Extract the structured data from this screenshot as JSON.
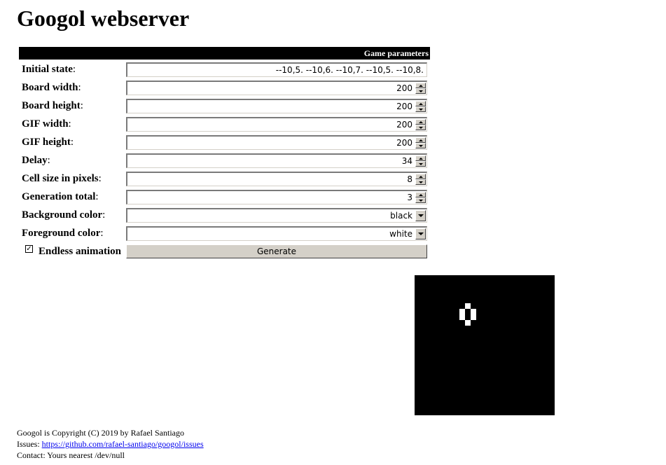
{
  "page": {
    "title": "Googol webserver"
  },
  "params": {
    "header": "Game parameters",
    "fields": [
      {
        "label": "Initial state",
        "value": "--10,5. --10,6. --10,7. --10,5. --10,8.",
        "kind": "text"
      },
      {
        "label": "Board width",
        "value": "200",
        "kind": "spin"
      },
      {
        "label": "Board height",
        "value": "200",
        "kind": "spin"
      },
      {
        "label": "GIF width",
        "value": "200",
        "kind": "spin"
      },
      {
        "label": "GIF height",
        "value": "200",
        "kind": "spin"
      },
      {
        "label": "Delay",
        "value": "34",
        "kind": "spin"
      },
      {
        "label": "Cell size in pixels",
        "value": "8",
        "kind": "spin"
      },
      {
        "label": "Generation total",
        "value": "3",
        "kind": "spin"
      },
      {
        "label": "Background color",
        "value": "black",
        "kind": "select"
      },
      {
        "label": "Foreground color",
        "value": "white",
        "kind": "select"
      }
    ],
    "separator": ":",
    "endless_label": "Endless animation",
    "endless_checked": true,
    "checkmark": "✓",
    "generate_label": "Generate"
  },
  "board": {
    "background_color": "#000000",
    "cell_color": "#ffffff",
    "live_cells": [
      [
        9,
        5
      ],
      [
        8,
        6
      ],
      [
        10,
        6
      ],
      [
        8,
        7
      ],
      [
        10,
        7
      ],
      [
        9,
        8
      ]
    ]
  },
  "footer": {
    "copyright": "Googol is Copyright (C) 2019 by Rafael Santiago",
    "issues_label": "Issues: ",
    "issues_link": "https://github.com/rafael-santiago/googol/issues",
    "contact": "Contact: Yours nearest /dev/null"
  }
}
